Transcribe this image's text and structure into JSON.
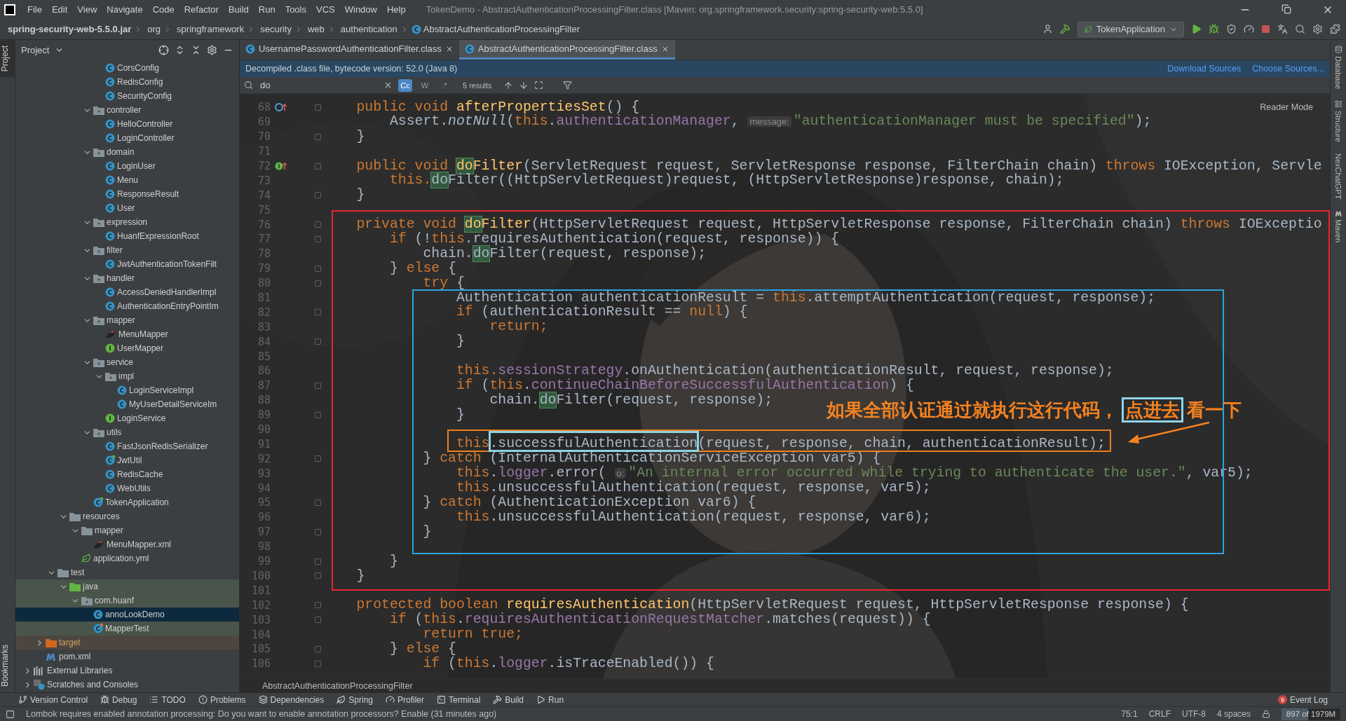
{
  "window": {
    "title": "TokenDemo - AbstractAuthenticationProcessingFilter.class [Maven: org.springframework.security:spring-security-web:5.5.0]"
  },
  "menu": [
    "File",
    "Edit",
    "View",
    "Navigate",
    "Code",
    "Refactor",
    "Build",
    "Run",
    "Tools",
    "VCS",
    "Window",
    "Help"
  ],
  "breadcrumb": [
    {
      "label": "spring-security-web-5.5.0.jar",
      "kind": "jar"
    },
    {
      "label": "org",
      "kind": "package"
    },
    {
      "label": "springframework",
      "kind": "package"
    },
    {
      "label": "security",
      "kind": "package"
    },
    {
      "label": "web",
      "kind": "package"
    },
    {
      "label": "authentication",
      "kind": "package"
    },
    {
      "label": "AbstractAuthenticationProcessingFilter",
      "kind": "class"
    }
  ],
  "run_config": "TokenApplication",
  "project_panel": {
    "title": "Project",
    "tree": [
      {
        "children": [
          {
            "children": [
              {
                "children": [
                  {
                    "children": [
                      {
                        "children": [
                          {
                            "children": [
                              {
                                "label": "CorsConfig",
                                "kind": "class",
                                "selected": false
                              },
                              {
                                "label": "RedisConfig",
                                "kind": "class",
                                "selected": false
                              },
                              {
                                "label": "SecurityConfig",
                                "kind": "class",
                                "selected": false
                              }
                            ]
                          },
                          {
                            "label": "controller",
                            "kind": "folder",
                            "expanded": true,
                            "selected": false,
                            "children": [
                              {
                                "label": "HelloController",
                                "kind": "class",
                                "selected": false
                              },
                              {
                                "label": "LoginController",
                                "kind": "class",
                                "selected": false
                              }
                            ]
                          },
                          {
                            "label": "domain",
                            "kind": "folder",
                            "expanded": true,
                            "selected": false,
                            "children": [
                              {
                                "label": "LoginUser",
                                "kind": "class",
                                "selected": false
                              },
                              {
                                "label": "Menu",
                                "kind": "class",
                                "selected": false
                              },
                              {
                                "label": "ResponseResult",
                                "kind": "class",
                                "selected": false
                              },
                              {
                                "label": "User",
                                "kind": "class",
                                "selected": false
                              }
                            ]
                          },
                          {
                            "label": "expression",
                            "kind": "folder",
                            "expanded": true,
                            "selected": false,
                            "children": [
                              {
                                "label": "HuanfExpressionRoot",
                                "kind": "class",
                                "selected": false
                              }
                            ]
                          },
                          {
                            "label": "filter",
                            "kind": "folder",
                            "expanded": true,
                            "selected": false,
                            "children": [
                              {
                                "label": "JwtAuthenticationTokenFilt",
                                "kind": "class",
                                "selected": false
                              }
                            ]
                          },
                          {
                            "label": "handler",
                            "kind": "folder",
                            "expanded": true,
                            "selected": false,
                            "children": [
                              {
                                "label": "AccessDeniedHandlerImpl",
                                "kind": "class",
                                "selected": false
                              },
                              {
                                "label": "AuthenticationEntryPointIm",
                                "kind": "class",
                                "selected": false
                              }
                            ]
                          },
                          {
                            "label": "mapper",
                            "kind": "folder",
                            "expanded": true,
                            "selected": false,
                            "children": [
                              {
                                "label": "MenuMapper",
                                "kind": "mapper",
                                "selected": false
                              },
                              {
                                "label": "UserMapper",
                                "kind": "interface",
                                "selected": false
                              }
                            ]
                          },
                          {
                            "label": "service",
                            "kind": "folder",
                            "expanded": true,
                            "selected": false,
                            "children": [
                              {
                                "label": "impl",
                                "kind": "folder",
                                "expanded": true,
                                "selected": false,
                                "children": [
                                  {
                                    "label": "LoginServiceImpl",
                                    "kind": "class",
                                    "selected": false
                                  },
                                  {
                                    "label": "MyUserDetailServiceIm",
                                    "kind": "class",
                                    "selected": false
                                  }
                                ]
                              },
                              {
                                "label": "LoginService",
                                "kind": "interface",
                                "selected": false
                              }
                            ]
                          },
                          {
                            "label": "utils",
                            "kind": "folder",
                            "expanded": true,
                            "selected": false,
                            "children": [
                              {
                                "label": "FastJsonRedisSerializer",
                                "kind": "class",
                                "selected": false
                              },
                              {
                                "label": "JwtUtil",
                                "kind": "class-marked",
                                "selected": false
                              },
                              {
                                "label": "RedisCache",
                                "kind": "class",
                                "selected": false
                              },
                              {
                                "label": "WebUtils",
                                "kind": "class",
                                "selected": false
                              }
                            ]
                          },
                          {
                            "label": "TokenApplication",
                            "kind": "app",
                            "selected": false
                          }
                        ]
                      }
                    ]
                  },
                  {
                    "label": "resources",
                    "kind": "resources",
                    "expanded": true,
                    "selected": false,
                    "children": [
                      {
                        "label": "mapper",
                        "kind": "folder-plain",
                        "expanded": true,
                        "selected": false,
                        "children": [
                          {
                            "label": "MenuMapper.xml",
                            "kind": "mapper-xml",
                            "selected": false
                          }
                        ]
                      },
                      {
                        "label": "application.yml",
                        "kind": "yml",
                        "selected": false
                      }
                    ]
                  }
                ]
              },
              {
                "label": "test",
                "kind": "folder-plain",
                "expanded": true,
                "selected": false,
                "children": [
                  {
                    "label": "java",
                    "kind": "test-root",
                    "expanded": true,
                    "selected": false,
                    "children": [
                      {
                        "label": "com.huanf",
                        "kind": "test-package",
                        "expanded": true,
                        "selected": false,
                        "children": [
                          {
                            "label": "annoLookDemo",
                            "kind": "class",
                            "selected": true
                          },
                          {
                            "label": "MapperTest",
                            "kind": "test-class",
                            "selected": false
                          }
                        ]
                      }
                    ]
                  }
                ]
              }
            ]
          },
          {
            "label": "target",
            "kind": "excluded",
            "expanded": false,
            "selected": false
          },
          {
            "label": "pom.xml",
            "kind": "maven",
            "selected": false
          }
        ]
      },
      {
        "label": "External Libraries",
        "kind": "libraries",
        "expanded": false,
        "selected": false
      },
      {
        "label": "Scratches and Consoles",
        "kind": "scratches",
        "expanded": false,
        "selected": false
      }
    ]
  },
  "left_strip": [
    {
      "label": "Project",
      "selected": true
    },
    {
      "label": "Bookmarks",
      "selected": false
    }
  ],
  "right_strip": [
    {
      "label": "Database",
      "kind": "database"
    },
    {
      "label": "Structure",
      "kind": "structure"
    },
    {
      "label": "NexChatGPT",
      "kind": "plain"
    },
    {
      "label": "Maven",
      "kind": "maven"
    }
  ],
  "tabs": [
    {
      "label": "UsernamePasswordAuthenticationFilter.class",
      "selected": false
    },
    {
      "label": "AbstractAuthenticationProcessingFilter.class",
      "selected": true
    }
  ],
  "banner": {
    "text": "Decompiled .class file, bytecode version: 52.0 (Java 8)",
    "links": [
      "Download Sources",
      "Choose Sources..."
    ]
  },
  "search": {
    "value": "do",
    "toggles": [
      {
        "label": "Cc",
        "selected": true
      },
      {
        "label": "W",
        "selected": false
      },
      {
        "label": ".*",
        "selected": false
      }
    ],
    "results": "5 results"
  },
  "reader_mode": "Reader Mode",
  "lines": [
    {
      "n": "68",
      "fold": true,
      "kind": "override",
      "segs": [
        {
          "kind": "kw",
          "text": "    public void "
        },
        {
          "kind": "fn",
          "text": "afterPropertiesSet"
        },
        {
          "kind": "t",
          "text": "() {"
        }
      ]
    },
    {
      "n": "69",
      "fold": false,
      "segs": [
        {
          "kind": "t",
          "text": "        Assert."
        },
        {
          "kind": "it",
          "text": "notNull"
        },
        {
          "kind": "t",
          "text": "("
        },
        {
          "kind": "kw",
          "text": "this"
        },
        {
          "kind": "t",
          "text": "."
        },
        {
          "kind": "field",
          "text": "authenticationManager"
        },
        {
          "kind": "t",
          "text": ", "
        },
        {
          "kind": "hint",
          "text": "message:"
        },
        {
          "kind": "str",
          "text": "\"authenticationManager must be specified\""
        },
        {
          "kind": "t",
          "text": ");"
        }
      ]
    },
    {
      "n": "70",
      "fold": true,
      "segs": [
        {
          "kind": "t",
          "text": "    }"
        }
      ]
    },
    {
      "n": "71",
      "fold": false
    },
    {
      "n": "72",
      "fold": true,
      "kind": "implement",
      "segs": [
        {
          "kind": "kw",
          "text": "    public void "
        },
        {
          "kind": "fnmatch",
          "text": "do"
        },
        {
          "kind": "fn",
          "text": "Filter"
        },
        {
          "kind": "t",
          "text": "(ServletRequest request, ServletResponse response, FilterChain chain) "
        },
        {
          "kind": "kw",
          "text": "throws "
        },
        {
          "kind": "t",
          "text": "IOException, Servle"
        }
      ]
    },
    {
      "n": "73",
      "fold": false,
      "segs": [
        {
          "kind": "kw",
          "text": "        this."
        },
        {
          "kind": "match",
          "text": "do"
        },
        {
          "kind": "t",
          "text": "Filter((HttpServletRequest)request, (HttpServletResponse)response, chain);"
        }
      ]
    },
    {
      "n": "74",
      "fold": true,
      "segs": [
        {
          "kind": "t",
          "text": "    }"
        }
      ]
    },
    {
      "n": "75",
      "fold": false
    },
    {
      "n": "76",
      "fold": true,
      "segs": [
        {
          "kind": "kw",
          "text": "    private void "
        },
        {
          "kind": "fnmatch",
          "text": "do"
        },
        {
          "kind": "fn",
          "text": "Filter"
        },
        {
          "kind": "t",
          "text": "(HttpServletRequest request, HttpServletResponse response, FilterChain chain) "
        },
        {
          "kind": "kw",
          "text": "throws "
        },
        {
          "kind": "t",
          "text": "IOExceptio"
        }
      ]
    },
    {
      "n": "77",
      "fold": true,
      "segs": [
        {
          "kind": "kw",
          "text": "        if "
        },
        {
          "kind": "t",
          "text": "(!"
        },
        {
          "kind": "kw",
          "text": "this"
        },
        {
          "kind": "t",
          "text": ".requiresAuthentication(request, response)) {"
        }
      ]
    },
    {
      "n": "78",
      "fold": false,
      "segs": [
        {
          "kind": "t",
          "text": "            chain."
        },
        {
          "kind": "match",
          "text": "do"
        },
        {
          "kind": "t",
          "text": "Filter(request, response);"
        }
      ]
    },
    {
      "n": "79",
      "fold": true,
      "segs": [
        {
          "kind": "t",
          "text": "        } "
        },
        {
          "kind": "kw",
          "text": "else"
        },
        {
          "kind": "t",
          "text": " {"
        }
      ]
    },
    {
      "n": "80",
      "fold": true,
      "segs": [
        {
          "kind": "kw",
          "text": "            try"
        },
        {
          "kind": "t",
          "text": " {"
        }
      ]
    },
    {
      "n": "81",
      "fold": false,
      "segs": [
        {
          "kind": "t",
          "text": "                Authentication authenticationResult = "
        },
        {
          "kind": "kw",
          "text": "this"
        },
        {
          "kind": "t",
          "text": ".attemptAuthentication(request, response);"
        }
      ]
    },
    {
      "n": "82",
      "fold": true,
      "segs": [
        {
          "kind": "kw",
          "text": "                if "
        },
        {
          "kind": "t",
          "text": "(authenticationResult == "
        },
        {
          "kind": "kw",
          "text": "null"
        },
        {
          "kind": "t",
          "text": ") {"
        }
      ]
    },
    {
      "n": "83",
      "fold": false,
      "segs": [
        {
          "kind": "kw",
          "text": "                    return;"
        }
      ]
    },
    {
      "n": "84",
      "fold": true,
      "segs": [
        {
          "kind": "t",
          "text": "                }"
        }
      ]
    },
    {
      "n": "85",
      "fold": false
    },
    {
      "n": "86",
      "fold": false,
      "segs": [
        {
          "kind": "kw",
          "text": "                this."
        },
        {
          "kind": "field",
          "text": "sessionStrategy"
        },
        {
          "kind": "t",
          "text": ".onAuthentication(authenticationResult, request, response);"
        }
      ]
    },
    {
      "n": "87",
      "fold": true,
      "segs": [
        {
          "kind": "kw",
          "text": "                if "
        },
        {
          "kind": "t",
          "text": "("
        },
        {
          "kind": "kw",
          "text": "this"
        },
        {
          "kind": "t",
          "text": "."
        },
        {
          "kind": "field",
          "text": "continueChainBeforeSuccessfulAuthentication"
        },
        {
          "kind": "t",
          "text": ") {"
        }
      ]
    },
    {
      "n": "88",
      "fold": false,
      "segs": [
        {
          "kind": "t",
          "text": "                    chain."
        },
        {
          "kind": "match",
          "text": "do"
        },
        {
          "kind": "t",
          "text": "Filter(request, response);"
        }
      ]
    },
    {
      "n": "89",
      "fold": true,
      "segs": [
        {
          "kind": "t",
          "text": "                }"
        }
      ]
    },
    {
      "n": "90",
      "fold": false
    },
    {
      "n": "91",
      "fold": false,
      "segs": [
        {
          "kind": "kw",
          "text": "                this"
        },
        {
          "kind": "t",
          "text": ".successfulAuthentication(request, response, chain, authenticationResult);"
        }
      ]
    },
    {
      "n": "92",
      "fold": true,
      "segs": [
        {
          "kind": "t",
          "text": "            } "
        },
        {
          "kind": "kw",
          "text": "catch"
        },
        {
          "kind": "t",
          "text": " (InternalAuthenticationServiceException var5) {"
        }
      ]
    },
    {
      "n": "93",
      "fold": false,
      "segs": [
        {
          "kind": "kw",
          "text": "                this"
        },
        {
          "kind": "t",
          "text": "."
        },
        {
          "kind": "field",
          "text": "logger"
        },
        {
          "kind": "t",
          "text": ".error( "
        },
        {
          "kind": "hint",
          "text": "o:"
        },
        {
          "kind": "str",
          "text": "\"An internal error occurred while trying to authenticate the user.\""
        },
        {
          "kind": "t",
          "text": ", var5);"
        }
      ]
    },
    {
      "n": "94",
      "fold": false,
      "segs": [
        {
          "kind": "kw",
          "text": "                this"
        },
        {
          "kind": "t",
          "text": ".unsuccessfulAuthentication(request, response, var5);"
        }
      ]
    },
    {
      "n": "95",
      "fold": true,
      "segs": [
        {
          "kind": "t",
          "text": "            } "
        },
        {
          "kind": "kw",
          "text": "catch"
        },
        {
          "kind": "t",
          "text": " (AuthenticationException var6) {"
        }
      ]
    },
    {
      "n": "96",
      "fold": false,
      "segs": [
        {
          "kind": "kw",
          "text": "                this"
        },
        {
          "kind": "t",
          "text": ".unsuccessfulAuthentication(request, response, var6);"
        }
      ]
    },
    {
      "n": "97",
      "fold": true,
      "segs": [
        {
          "kind": "t",
          "text": "            }"
        }
      ]
    },
    {
      "n": "98",
      "fold": false
    },
    {
      "n": "99",
      "fold": true,
      "segs": [
        {
          "kind": "t",
          "text": "        }"
        }
      ]
    },
    {
      "n": "100",
      "fold": true,
      "segs": [
        {
          "kind": "t",
          "text": "    }"
        }
      ]
    },
    {
      "n": "101",
      "fold": false
    },
    {
      "n": "102",
      "fold": true,
      "segs": [
        {
          "kind": "kw",
          "text": "    protected boolean "
        },
        {
          "kind": "fn",
          "text": "requiresAuthentication"
        },
        {
          "kind": "t",
          "text": "(HttpServletRequest request, HttpServletResponse response) {"
        }
      ]
    },
    {
      "n": "103",
      "fold": true,
      "segs": [
        {
          "kind": "kw",
          "text": "        if "
        },
        {
          "kind": "t",
          "text": "("
        },
        {
          "kind": "kw",
          "text": "this"
        },
        {
          "kind": "t",
          "text": "."
        },
        {
          "kind": "field",
          "text": "requiresAuthenticationRequestMatcher"
        },
        {
          "kind": "t",
          "text": ".matches(request)) {"
        }
      ]
    },
    {
      "n": "104",
      "fold": false,
      "segs": [
        {
          "kind": "kw",
          "text": "            return true;"
        }
      ]
    },
    {
      "n": "105",
      "fold": true,
      "segs": [
        {
          "kind": "t",
          "text": "        } "
        },
        {
          "kind": "kw",
          "text": "else"
        },
        {
          "kind": "t",
          "text": " {"
        }
      ]
    },
    {
      "n": "106",
      "fold": true,
      "segs": [
        {
          "kind": "kw",
          "text": "            if "
        },
        {
          "kind": "t",
          "text": "("
        },
        {
          "kind": "kw",
          "text": "this"
        },
        {
          "kind": "t",
          "text": "."
        },
        {
          "kind": "field",
          "text": "logger"
        },
        {
          "kind": "t",
          "text": ".isTraceEnabled()) {"
        }
      ]
    }
  ],
  "annotations": {
    "boxes": [
      {
        "kind": "outer",
        "color": "#e8262d"
      },
      {
        "kind": "inner",
        "color": "#2ba3e0"
      },
      {
        "kind": "statement",
        "color": "#f07f1e"
      },
      {
        "kind": "word",
        "color": "#8fd3e6"
      }
    ],
    "note": [
      {
        "text": "如果全部认证通过就执行这行代码，",
        "boxed": false
      },
      {
        "text": "点进去",
        "boxed": true
      },
      {
        "text": "看一下",
        "boxed": false
      }
    ]
  },
  "editor_breadcrumb": "AbstractAuthenticationProcessingFilter",
  "tool_windows": [
    {
      "label": "Version Control",
      "kind": "vcs"
    },
    {
      "label": "Debug",
      "kind": "debug"
    },
    {
      "label": "TODO",
      "kind": "todo"
    },
    {
      "label": "Problems",
      "kind": "problems"
    },
    {
      "label": "Dependencies",
      "kind": "dependencies"
    },
    {
      "label": "Spring",
      "kind": "spring"
    },
    {
      "label": "Profiler",
      "kind": "profiler"
    },
    {
      "label": "Terminal",
      "kind": "terminal"
    },
    {
      "label": "Build",
      "kind": "build"
    },
    {
      "label": "Run",
      "kind": "run"
    }
  ],
  "event_log": {
    "label": "Event Log",
    "count": "9"
  },
  "status_bar": {
    "message": "Lombok requires enabled annotation processing: Do you want to enable annotation processors? Enable (31 minutes ago)",
    "position": "75:1",
    "line_separator": "CRLF",
    "encoding": "UTF-8",
    "indent": "4 spaces",
    "memory": {
      "text": "897 of 1979M",
      "level": 0.45
    }
  }
}
